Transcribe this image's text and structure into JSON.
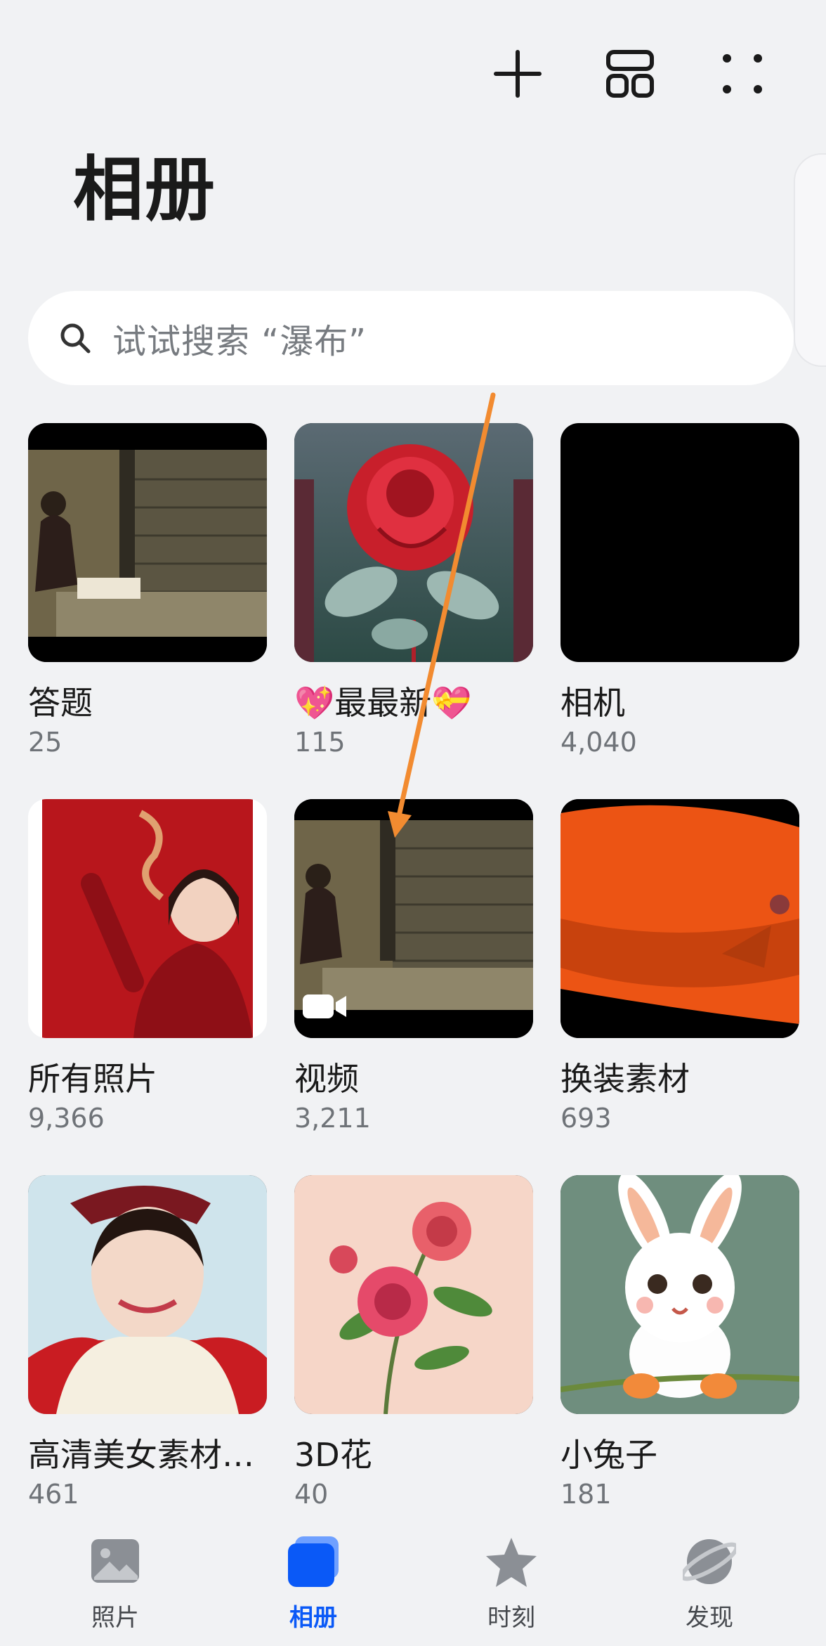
{
  "header": {
    "title": "相册",
    "icons": [
      "add-icon",
      "layout-icon",
      "more-icon"
    ]
  },
  "search": {
    "placeholder": "试试搜索 “瀑布”"
  },
  "albums": [
    {
      "name": "答题",
      "count": "25"
    },
    {
      "name": "💖最最新💝",
      "count": "115"
    },
    {
      "name": "相机",
      "count": "4,040"
    },
    {
      "name": "所有照片",
      "count": "9,366"
    },
    {
      "name": "视频",
      "count": "3,211"
    },
    {
      "name": "换装素材",
      "count": "693"
    },
    {
      "name": "高清美女素材…",
      "count": "461"
    },
    {
      "name": "3D花",
      "count": "40"
    },
    {
      "name": "小兔子",
      "count": "181"
    }
  ],
  "bottom_nav": {
    "items": [
      {
        "label": "照片",
        "icon": "photos-icon"
      },
      {
        "label": "相册",
        "icon": "albums-icon",
        "active": true
      },
      {
        "label": "时刻",
        "icon": "moments-icon"
      },
      {
        "label": "发现",
        "icon": "discover-icon"
      }
    ]
  },
  "colors": {
    "background": "#f1f2f4",
    "accent": "#0a59f7",
    "annotation_arrow": "#f28b30"
  }
}
